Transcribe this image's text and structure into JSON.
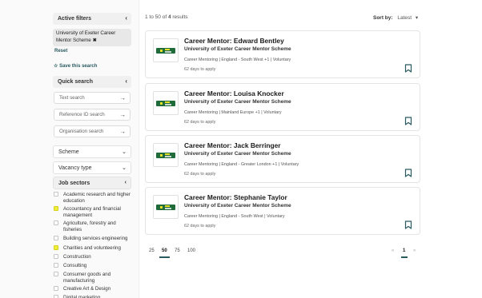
{
  "sidebar": {
    "active_filters": {
      "title": "Active filters",
      "chip_line1": "University of Exeter Career",
      "chip_line2": "Mentor Scheme",
      "chip_remove": "✖",
      "reset": "Reset"
    },
    "save_search": "Save this search",
    "quick_search": {
      "title": "Quick search",
      "text_placeholder": "Text search",
      "ref_placeholder": "Reference ID search",
      "org_placeholder": "Organisation search"
    },
    "dropdowns": {
      "scheme": "Scheme",
      "vacancy_type": "Vacancy type",
      "job_sectors": "Job sectors"
    },
    "sectors": [
      {
        "line1": "Academic research and higher",
        "line2": "education",
        "checked": false
      },
      {
        "line1": "Accountancy and financial",
        "line2": "management",
        "checked": true
      },
      {
        "line1": "Agriculture, forestry and",
        "line2": "fisheries",
        "checked": false
      },
      {
        "line1": "Building services engineering",
        "line2": "",
        "checked": false
      },
      {
        "line1": "Charities and volunteering",
        "line2": "",
        "checked": true
      },
      {
        "line1": "Construction",
        "line2": "",
        "checked": false
      },
      {
        "line1": "Consulting",
        "line2": "",
        "checked": false
      },
      {
        "line1": "Consumer goods and",
        "line2": "manufacturing",
        "checked": false
      },
      {
        "line1": "Creative Art & Design",
        "line2": "",
        "checked": false
      },
      {
        "line1": "Digital marketing",
        "line2": "",
        "checked": false
      }
    ]
  },
  "results": {
    "range": "1 to 50",
    "of": "of",
    "total": "4",
    "suffix": "results",
    "sort_label": "Sort by:",
    "sort_value": "Latest"
  },
  "cards": [
    {
      "title": "Career Mentor: Edward Bentley",
      "org": "University of Exeter Career Mentor Scheme",
      "meta": "Career Mentoring | England - South West +1 | Voluntary",
      "days": "62 days to apply"
    },
    {
      "title": "Career Mentor: Louisa Knocker",
      "org": "University of Exeter Career Mentor Scheme",
      "meta": "Career Mentoring | Mainland Europe +1 | Voluntary",
      "days": "62 days to apply"
    },
    {
      "title": "Career Mentor: Jack Berringer",
      "org": "University of Exeter Career Mentor Scheme",
      "meta": "Career Mentoring | England - Greater London +1 | Voluntary",
      "days": "62 days to apply"
    },
    {
      "title": "Career Mentor: Stephanie Taylor",
      "org": "University of Exeter Career Mentor Scheme",
      "meta": "Career Mentoring | England - South West | Voluntary",
      "days": "62 days to apply"
    }
  ],
  "page_sizes": [
    "25",
    "50",
    "75",
    "100"
  ],
  "pagination": {
    "prev": "«",
    "current": "1",
    "next": "»"
  },
  "colors": {
    "accent": "#2a5a60",
    "checkbox_checked": "#f0ec3a",
    "logo_green": "#1f6b3a"
  },
  "icons": {
    "chevron_left": "‹",
    "arrow_right": "→",
    "chevron_down": "⌄",
    "bookmark": "bookmark-icon",
    "star": "☆"
  }
}
